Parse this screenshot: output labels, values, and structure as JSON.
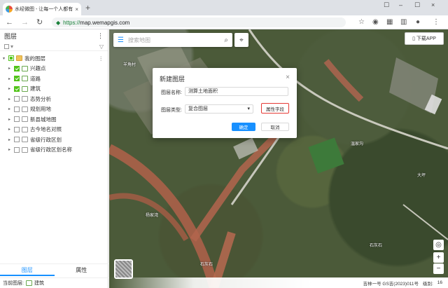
{
  "browser": {
    "tab_title": "水经微图 - 让每一个人都有自",
    "tab_close": "×",
    "new_tab": "+",
    "url_scheme": "https://",
    "url_host": "map.wemapgis.com",
    "window_buttons": [
      "☐",
      "–",
      "☐",
      "×"
    ]
  },
  "layers_panel": {
    "title": "图层",
    "tree": [
      {
        "label": "我的图层",
        "level": 0,
        "checked": "partial",
        "icon": "folder-icon",
        "has_more": true
      },
      {
        "label": "兴趣点",
        "level": 1,
        "checked": true,
        "icon": "point-layer-icon"
      },
      {
        "label": "道路",
        "level": 1,
        "checked": true,
        "icon": "line-layer-icon"
      },
      {
        "label": "建筑",
        "level": 1,
        "checked": true,
        "icon": "polygon-layer-icon"
      },
      {
        "label": "态势分析",
        "level": 1,
        "checked": false,
        "icon": "layer-icon"
      },
      {
        "label": "规划用地",
        "level": 1,
        "checked": false,
        "icon": "layer-icon"
      },
      {
        "label": "新县城地图",
        "level": 1,
        "checked": false,
        "icon": "layer-icon"
      },
      {
        "label": "古今地名对照",
        "level": 1,
        "checked": false,
        "icon": "layer-icon"
      },
      {
        "label": "省级行政区划",
        "level": 1,
        "checked": false,
        "icon": "layer-icon"
      },
      {
        "label": "省级行政区划名称",
        "level": 1,
        "checked": false,
        "icon": "layer-icon"
      }
    ],
    "tabs": [
      "图层",
      "属性"
    ],
    "current_layer_label": "当前图层:",
    "current_layer_value": "建筑"
  },
  "map": {
    "search_placeholder": "搜索地图",
    "app_button": "下载APP",
    "labels": [
      "羊角村",
      "温家沟",
      "大坪",
      "石灰石",
      "杨家湾",
      "石灰石"
    ],
    "footer": {
      "source": "吉林一号 GS吉(2023)011号",
      "zoom_label": "级别:",
      "zoom": "16"
    }
  },
  "dialog": {
    "title": "新建图层",
    "name_label": "图层名称:",
    "name_value": "测算土地面积",
    "type_label": "图层类型:",
    "type_value": "复合图层",
    "attr_button": "属性字段",
    "ok": "确定",
    "cancel": "取消"
  }
}
